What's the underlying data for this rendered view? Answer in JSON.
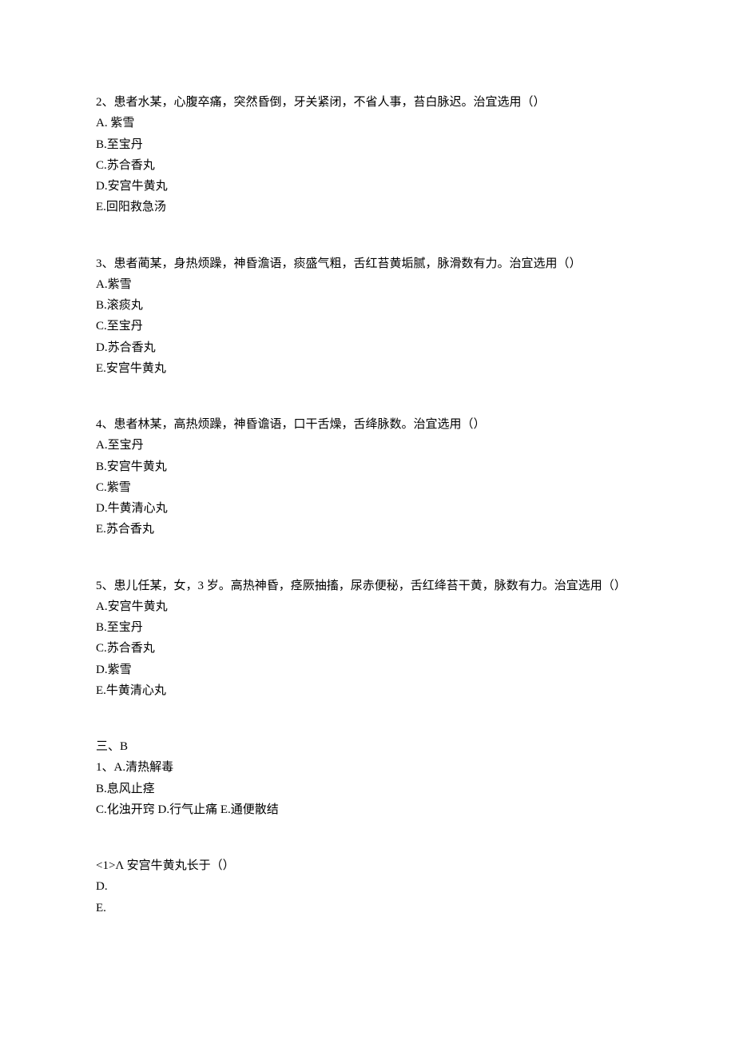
{
  "questions": [
    {
      "number": "2",
      "stem": "患者水某，心腹卒痛，突然昏倒，牙关紧闭，不省人事，苔白脉迟。治宜选用（）",
      "options": {
        "A": "紫雪",
        "B": "至宝丹",
        "C": "苏合香丸",
        "D": "安宫牛黄丸",
        "E": "回阳救急汤"
      }
    },
    {
      "number": "3",
      "stem": "患者蔺某，身热烦躁，神昏澹语，痰盛气粗，舌红苔黄垢腻，脉滑数有力。治宜选用（）",
      "options": {
        "A": "紫雪",
        "B": "滚痰丸",
        "C": "至宝丹",
        "D": "苏合香丸",
        "E": "安宫牛黄丸"
      }
    },
    {
      "number": "4",
      "stem": "患者林某，高热烦躁，神昏谵语，口干舌燥，舌绛脉数。治宜选用（）",
      "options": {
        "A": "至宝丹",
        "B": "安宫牛黄丸",
        "C": "紫雪",
        "D": "牛黄清心丸",
        "E": "苏合香丸"
      }
    },
    {
      "number": "5",
      "stem": "患儿任某，女，3 岁。高热神昏，痉厥抽搐，尿赤便秘，舌红绛苔干黄，脉数有力。治宜选用（）",
      "options": {
        "A": "安宫牛黄丸",
        "B": "至宝丹",
        "C": "苏合香丸",
        "D": "紫雪",
        "E": "牛黄清心丸"
      }
    }
  ],
  "section3": {
    "header": "三、B",
    "q1": {
      "number": "1",
      "optA": "A.清热解毒",
      "optB": "B.息风止痉",
      "optC": "C.化浊开窍",
      "optD": "D.行气止痛",
      "optE": "E.通便散结"
    }
  },
  "sub1": {
    "label": "<1>Λ",
    "stem": "安宫牛黄丸长于（）",
    "optD": "D.",
    "optE": "E."
  },
  "labels": {
    "A": "A.",
    "B": "B.",
    "C": "C.",
    "D": "D.",
    "E": "E.",
    "sep": "、"
  }
}
